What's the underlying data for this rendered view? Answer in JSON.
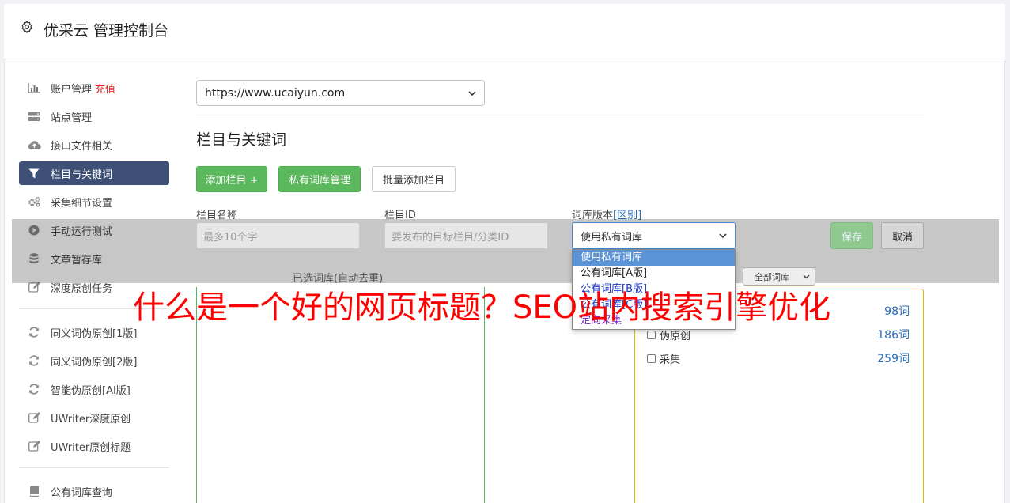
{
  "header": {
    "title": "优采云 管理控制台",
    "icon": "gear-icon"
  },
  "sidebar": {
    "items": [
      {
        "label": "账户管理",
        "badge": "充值",
        "icon": "bar-chart-icon"
      },
      {
        "label": "站点管理",
        "icon": "server-icon"
      },
      {
        "label": "接口文件相关",
        "icon": "cloud-upload-icon"
      },
      {
        "label": "栏目与关键词",
        "icon": "filter-icon",
        "active": true
      },
      {
        "label": "采集细节设置",
        "icon": "gears-icon"
      },
      {
        "label": "手动运行测试",
        "icon": "play-icon"
      },
      {
        "label": "文章暂存库",
        "icon": "database-icon"
      },
      {
        "label": "深度原创任务",
        "icon": "edit-icon"
      }
    ],
    "items2": [
      {
        "label": "同义词伪原创[1版]",
        "icon": "refresh-icon"
      },
      {
        "label": "同义词伪原创[2版]",
        "icon": "refresh-icon"
      },
      {
        "label": "智能伪原创[AI版]",
        "icon": "refresh-icon"
      },
      {
        "label": "UWriter深度原创",
        "icon": "edit-icon"
      },
      {
        "label": "UWriter原创标题",
        "icon": "edit-icon"
      }
    ],
    "items3": [
      {
        "label": "公有词库查询",
        "icon": "book-icon"
      }
    ]
  },
  "main": {
    "site_select": {
      "value": "https://www.ucaiyun.com"
    },
    "section_title": "栏目与关键词",
    "buttons": {
      "add_column": "添加栏目 +",
      "private_lib": "私有词库管理",
      "batch_add": "批量添加栏目"
    },
    "form": {
      "name_label": "栏目名称",
      "name_placeholder": "最多10个字",
      "id_label": "栏目ID",
      "id_placeholder": "要发布的目标栏目/分类ID",
      "version_label": "词库版本",
      "version_link": "[区别]",
      "version_value": "使用私有词库",
      "save": "保存",
      "cancel": "取消"
    },
    "dropdown_options": [
      "使用私有词库",
      "公有词库[A版]",
      "公有词库[B版]",
      "公有词库[C版]",
      "定向采集"
    ],
    "selected_label": "已选词库(自动去重)",
    "filter_select": "全部词库",
    "libraries": [
      {
        "name": "",
        "count": "98词"
      },
      {
        "name": "伪原创",
        "count": "186词"
      },
      {
        "name": "采集",
        "count": "259词"
      }
    ]
  },
  "watermark": "什么是一个好的网页标题？SEO站内搜索引擎优化",
  "colors": {
    "active_nav": "#3e5075",
    "green": "#5cb85c",
    "badge_red": "#e02020",
    "watermark_red": "#ff0000",
    "link_blue": "#2a6ebb"
  }
}
